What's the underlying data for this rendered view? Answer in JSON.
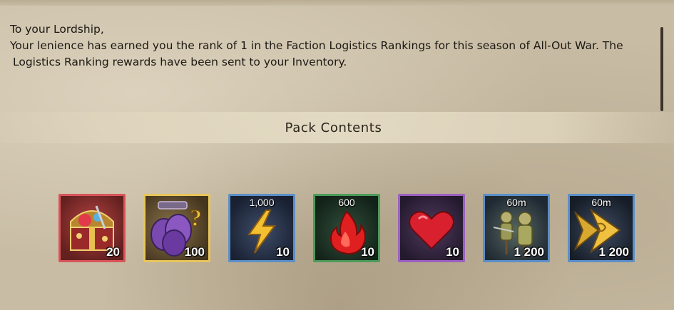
{
  "message": {
    "greeting": "To your Lordship,",
    "line1": "Your lenience has earned you the rank of 1 in the Faction Logistics Rankings for this season of All-Out War. The",
    "line2": "Logistics Ranking rewards have been sent to your Inventory."
  },
  "pack": {
    "title": "Pack Contents",
    "items": [
      {
        "icon": "treasure-chest-icon",
        "top_label": "",
        "quantity": "20",
        "border_color": "#d9545a",
        "bg": "#7a2c2a"
      },
      {
        "icon": "mystery-shields-icon",
        "top_label": "",
        "quantity": "100",
        "border_color": "#e8c55a",
        "bg": "#5a4a2a"
      },
      {
        "icon": "lightning-bolt-icon",
        "top_label": "1,000",
        "quantity": "10",
        "border_color": "#5b8fc7",
        "bg": "#2a3448"
      },
      {
        "icon": "flame-icon",
        "top_label": "600",
        "quantity": "10",
        "border_color": "#4d9a5a",
        "bg": "#203a2a"
      },
      {
        "icon": "heart-icon",
        "top_label": "",
        "quantity": "10",
        "border_color": "#9c5fc0",
        "bg": "#3a2a4a"
      },
      {
        "icon": "training-dummy-icon",
        "top_label": "60m",
        "quantity": "1 200",
        "border_color": "#5b8fc7",
        "bg": "#2c3a48"
      },
      {
        "icon": "speedup-arrows-icon",
        "top_label": "60m",
        "quantity": "1 200",
        "border_color": "#5b8fc7",
        "bg": "#2a3448"
      }
    ]
  }
}
